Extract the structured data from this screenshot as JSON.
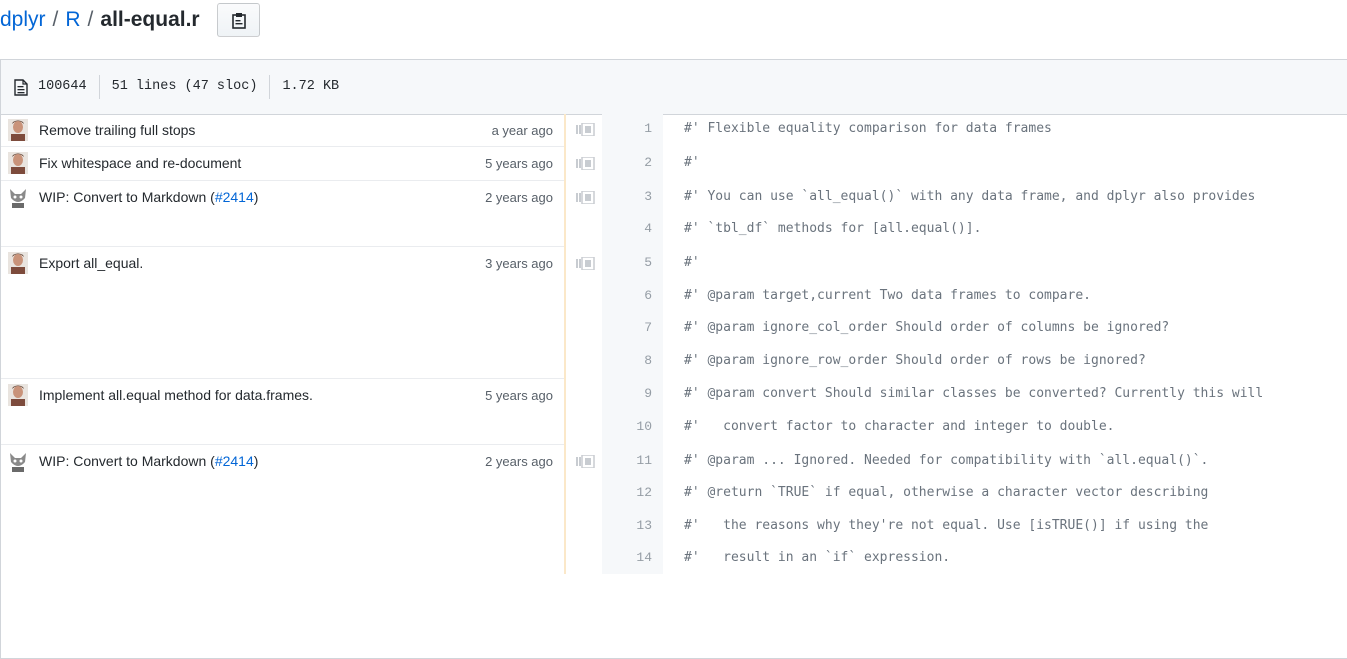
{
  "breadcrumb": {
    "repo": "dplyr",
    "sep1": "/",
    "dir": "R",
    "sep2": "/",
    "file": "all-equal.r"
  },
  "copy_button": {
    "icon": "clipboard-icon"
  },
  "file_info": {
    "icon": "file-icon",
    "mode": "100644",
    "lines": "51 lines (47 sloc)",
    "size": "1.72 KB"
  },
  "commits": [
    {
      "avatar": "author-photo",
      "message": "Remove trailing full stops",
      "pr": "",
      "age": "a year ago"
    },
    {
      "avatar": "author-photo",
      "message": "Fix whitespace and re-document",
      "pr": "",
      "age": "5 years ago"
    },
    {
      "avatar": "cat-avatar",
      "message": "WIP: Convert to Markdown (",
      "pr": "#2414",
      "close": ")",
      "age": "2 years ago"
    },
    {
      "avatar": "author-photo",
      "message": "Export all_equal.",
      "pr": "",
      "age": "3 years ago"
    },
    {
      "avatar": "author-photo",
      "message": "Implement all.equal method for data.frames.",
      "pr": "",
      "age": "5 years ago"
    },
    {
      "avatar": "cat-avatar",
      "message": "WIP: Convert to Markdown (",
      "pr": "#2414",
      "close": ")",
      "age": "2 years ago"
    }
  ],
  "lines": [
    {
      "n": "1",
      "text": "#' Flexible equality comparison for data frames"
    },
    {
      "n": "2",
      "text": "#'"
    },
    {
      "n": "3",
      "text": "#' You can use `all_equal()` with any data frame, and dplyr also provides"
    },
    {
      "n": "4",
      "text": "#' `tbl_df` methods for [all.equal()]."
    },
    {
      "n": "5",
      "text": "#'"
    },
    {
      "n": "6",
      "text": "#' @param target,current Two data frames to compare."
    },
    {
      "n": "7",
      "text": "#' @param ignore_col_order Should order of columns be ignored?"
    },
    {
      "n": "8",
      "text": "#' @param ignore_row_order Should order of rows be ignored?"
    },
    {
      "n": "9",
      "text": "#' @param convert Should similar classes be converted? Currently this will"
    },
    {
      "n": "10",
      "text": "#'   convert factor to character and integer to double."
    },
    {
      "n": "11",
      "text": "#' @param ... Ignored. Needed for compatibility with `all.equal()`."
    },
    {
      "n": "12",
      "text": "#' @return `TRUE` if equal, otherwise a character vector describing"
    },
    {
      "n": "13",
      "text": "#'   the reasons why they're not equal. Use [isTRUE()] if using the"
    },
    {
      "n": "14",
      "text": "#'   result in an `if` expression."
    }
  ]
}
